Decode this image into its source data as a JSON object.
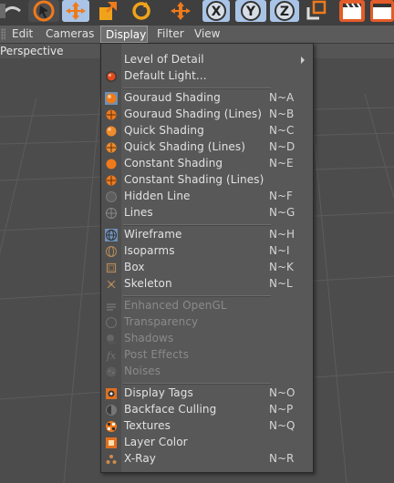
{
  "menubar": {
    "items": [
      {
        "label": "Edit"
      },
      {
        "label": "Cameras"
      },
      {
        "label": "Display",
        "active": true
      },
      {
        "label": "Filter"
      },
      {
        "label": "View"
      }
    ]
  },
  "viewport": {
    "label": "Perspective"
  },
  "colors": {
    "accent": "#f07a1a",
    "toolbar_blue": "#a9c4e6",
    "menu_bg": "#585858"
  },
  "display_menu": {
    "items": [
      {
        "label": "Level of Detail",
        "shortcut": "",
        "icon": "none",
        "submenu": true
      },
      {
        "label": "Default Light...",
        "shortcut": "",
        "icon": "light-icon"
      },
      {
        "label": "Gouraud Shading",
        "shortcut": "N~A",
        "icon": "gouraud-shading-icon",
        "selected": true
      },
      {
        "label": "Gouraud Shading (Lines)",
        "shortcut": "N~B",
        "icon": "gouraud-lines-icon"
      },
      {
        "label": "Quick Shading",
        "shortcut": "N~C",
        "icon": "quick-shading-icon"
      },
      {
        "label": "Quick Shading (Lines)",
        "shortcut": "N~D",
        "icon": "quick-lines-icon"
      },
      {
        "label": "Constant Shading",
        "shortcut": "N~E",
        "icon": "constant-shading-icon"
      },
      {
        "label": "Constant Shading (Lines)",
        "shortcut": "",
        "icon": "constant-lines-icon"
      },
      {
        "label": "Hidden Line",
        "shortcut": "N~F",
        "icon": "hidden-line-icon"
      },
      {
        "label": "Lines",
        "shortcut": "N~G",
        "icon": "lines-icon"
      },
      {
        "label": "Wireframe",
        "shortcut": "N~H",
        "icon": "wireframe-icon",
        "selected": true
      },
      {
        "label": "Isoparms",
        "shortcut": "N~I",
        "icon": "isoparms-icon"
      },
      {
        "label": "Box",
        "shortcut": "N~K",
        "icon": "box-icon"
      },
      {
        "label": "Skeleton",
        "shortcut": "N~L",
        "icon": "skeleton-icon"
      },
      {
        "label": "Enhanced OpenGL",
        "shortcut": "",
        "icon": "enhanced-opengl-icon",
        "disabled": true
      },
      {
        "label": "Transparency",
        "shortcut": "",
        "icon": "transparency-icon",
        "disabled": true
      },
      {
        "label": "Shadows",
        "shortcut": "",
        "icon": "shadows-icon",
        "disabled": true
      },
      {
        "label": "Post Effects",
        "shortcut": "",
        "icon": "post-effects-icon",
        "disabled": true
      },
      {
        "label": "Noises",
        "shortcut": "",
        "icon": "noises-icon",
        "disabled": true
      },
      {
        "label": "Display Tags",
        "shortcut": "N~O",
        "icon": "display-tags-icon"
      },
      {
        "label": "Backface Culling",
        "shortcut": "N~P",
        "icon": "backface-culling-icon"
      },
      {
        "label": "Textures",
        "shortcut": "N~Q",
        "icon": "textures-icon"
      },
      {
        "label": "Layer Color",
        "shortcut": "",
        "icon": "layer-color-icon"
      },
      {
        "label": "X-Ray",
        "shortcut": "N~R",
        "icon": "xray-icon"
      }
    ]
  }
}
